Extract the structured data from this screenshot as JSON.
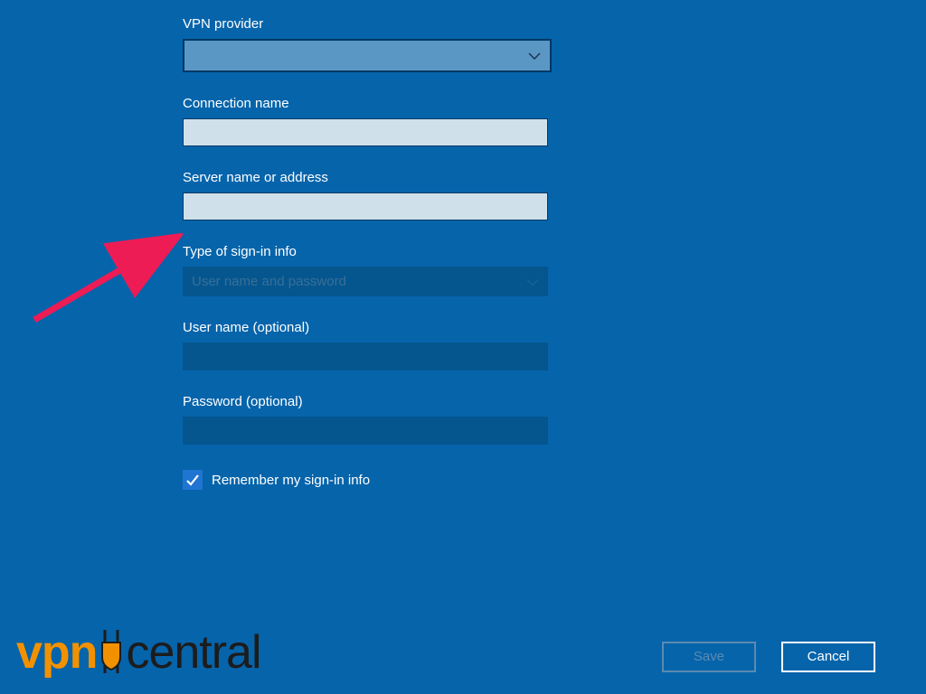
{
  "form": {
    "vpn_provider": {
      "label": "VPN provider",
      "value": ""
    },
    "connection_name": {
      "label": "Connection name",
      "value": ""
    },
    "server_address": {
      "label": "Server name or address",
      "value": ""
    },
    "signin_type": {
      "label": "Type of sign-in info",
      "selected": "User name and password"
    },
    "user_name": {
      "label": "User name (optional)",
      "value": ""
    },
    "password": {
      "label": "Password (optional)",
      "value": ""
    },
    "remember": {
      "label": "Remember my sign-in info",
      "checked": true
    }
  },
  "buttons": {
    "save": "Save",
    "cancel": "Cancel"
  },
  "logo": {
    "part1": "vpn",
    "part2": "central"
  }
}
